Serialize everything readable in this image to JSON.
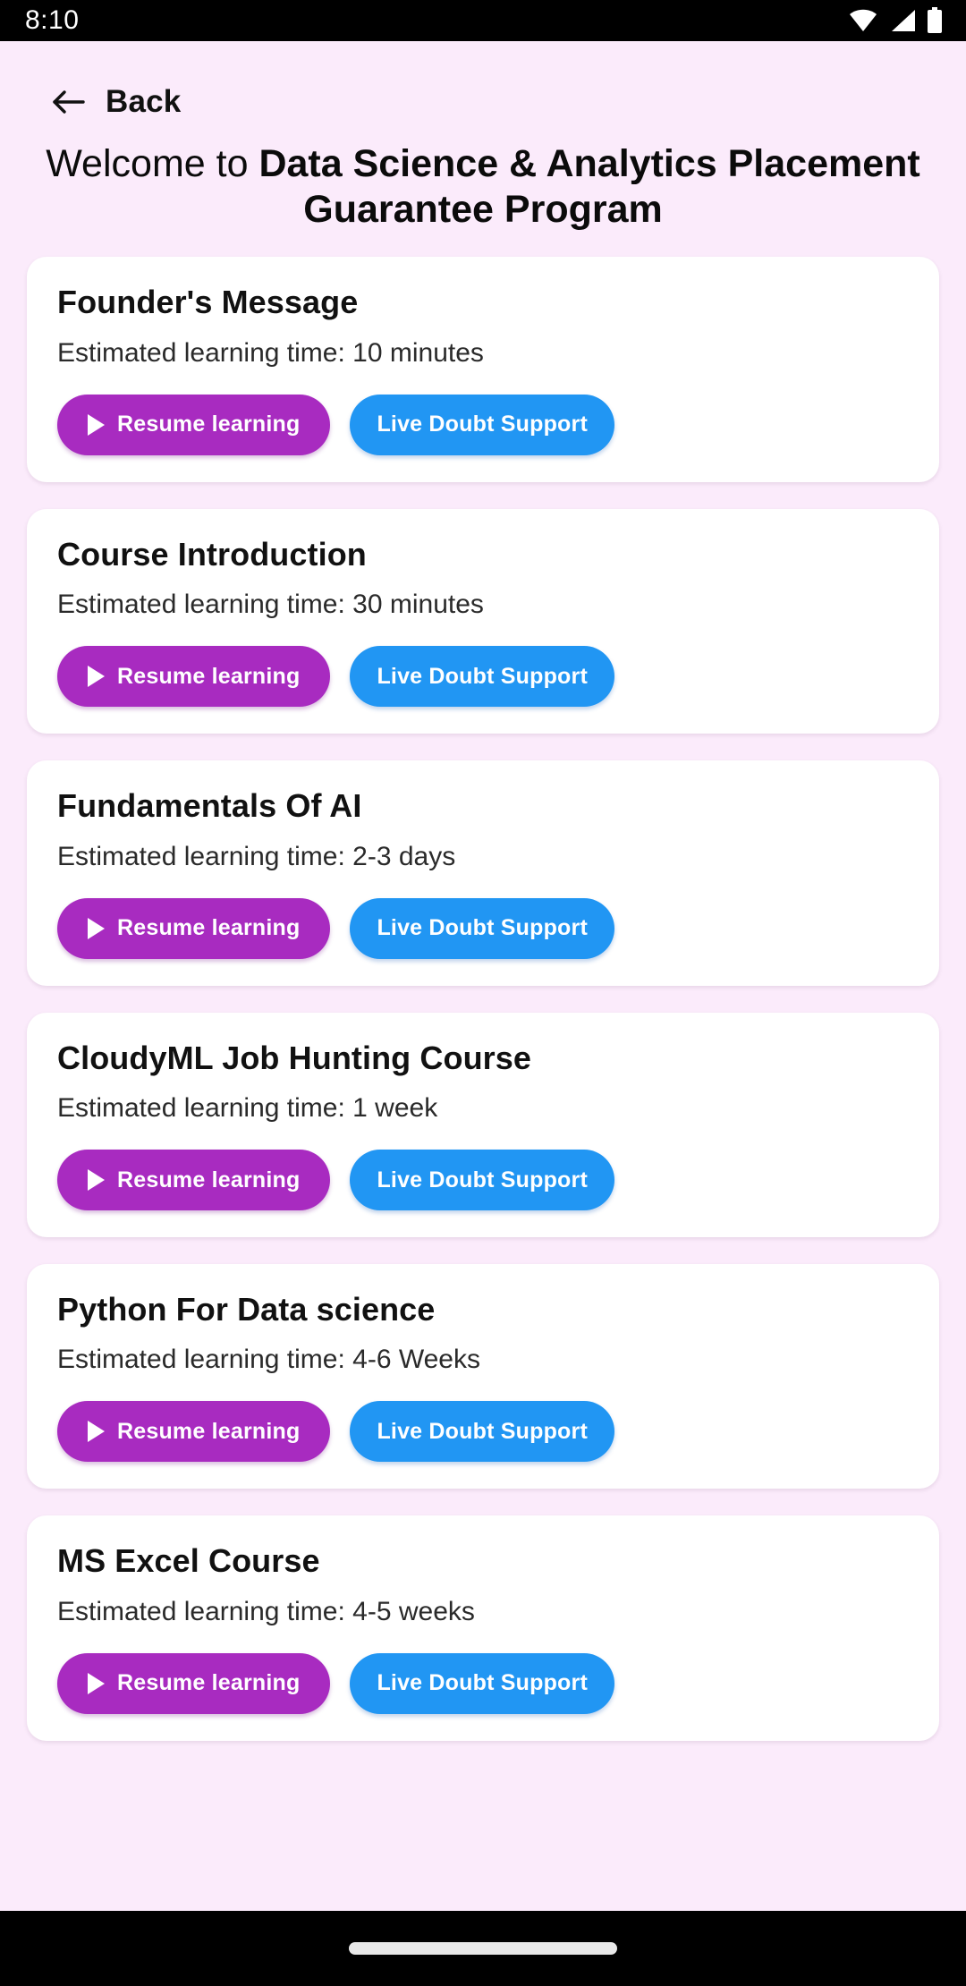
{
  "status_bar": {
    "time": "8:10",
    "icons": [
      "wifi-icon",
      "cellular-signal-icon",
      "battery-icon"
    ]
  },
  "nav": {
    "back_label": "Back",
    "back_icon": "arrow-left-icon"
  },
  "header": {
    "welcome_prefix": "Welcome to ",
    "program_name": "Data Science & Analytics Placement Guarantee Program"
  },
  "colors": {
    "page_background": "#FBEBFB",
    "card_background": "#FFFFFF",
    "resume_button": "#A82BC0",
    "support_button": "#2196F3",
    "status_bar": "#000000",
    "text_primary": "#111111"
  },
  "buttons": {
    "resume_label": "Resume learning",
    "resume_icon": "play-icon",
    "support_label": "Live Doubt Support"
  },
  "courses": [
    {
      "title": "Founder's Message",
      "time": "Estimated learning time: 10 minutes"
    },
    {
      "title": "Course Introduction",
      "time": "Estimated learning time: 30 minutes"
    },
    {
      "title": "Fundamentals Of AI",
      "time": "Estimated learning time: 2-3 days"
    },
    {
      "title": "CloudyML Job Hunting Course",
      "time": "Estimated learning time: 1 week"
    },
    {
      "title": "Python For Data science",
      "time": "Estimated learning time: 4-6 Weeks"
    },
    {
      "title": "MS Excel Course",
      "time": "Estimated learning time: 4-5 weeks"
    }
  ],
  "system_nav": {
    "gesture_pill": "home-gesture-pill"
  }
}
